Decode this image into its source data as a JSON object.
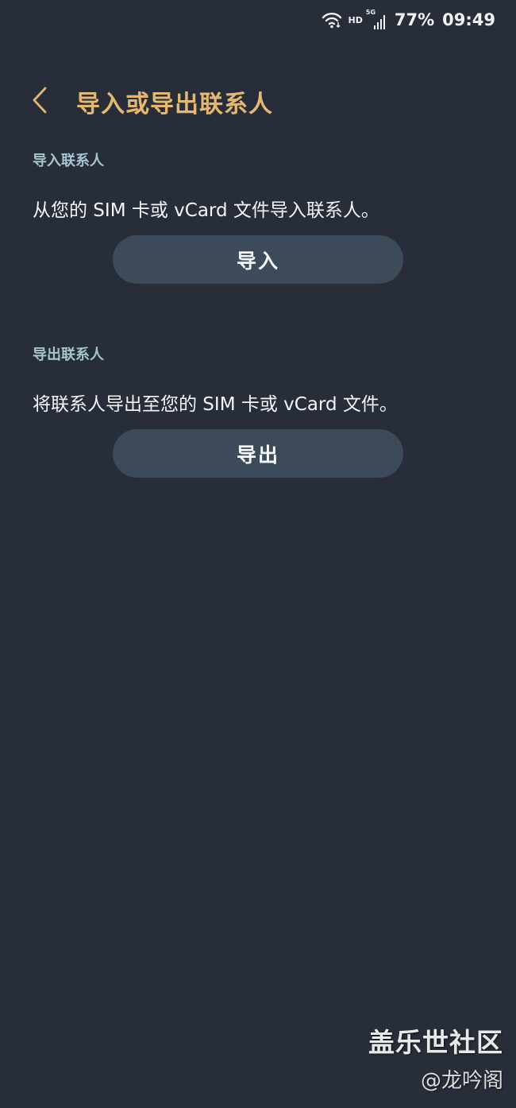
{
  "status_bar": {
    "hd": "HD",
    "network": "5G",
    "battery": "77%",
    "time": "09:49",
    "icons": [
      "wifi-icon",
      "signal-icon"
    ]
  },
  "header": {
    "back_icon": "chevron-left-icon",
    "title": "导入或导出联系人"
  },
  "import_section": {
    "label": "导入联系人",
    "description": "从您的 SIM 卡或 vCard 文件导入联系人。",
    "button_label": "导入"
  },
  "export_section": {
    "label": "导出联系人",
    "description": "将联系人导出至您的 SIM 卡或 vCard 文件。",
    "button_label": "导出"
  },
  "watermark": {
    "main": "盖乐世社区",
    "sub": "@龙吟阁"
  },
  "colors": {
    "background": "#282e39",
    "title_accent": "#e4b873",
    "section_label": "#a6c6cf",
    "button_bg": "#3d4a5a"
  }
}
